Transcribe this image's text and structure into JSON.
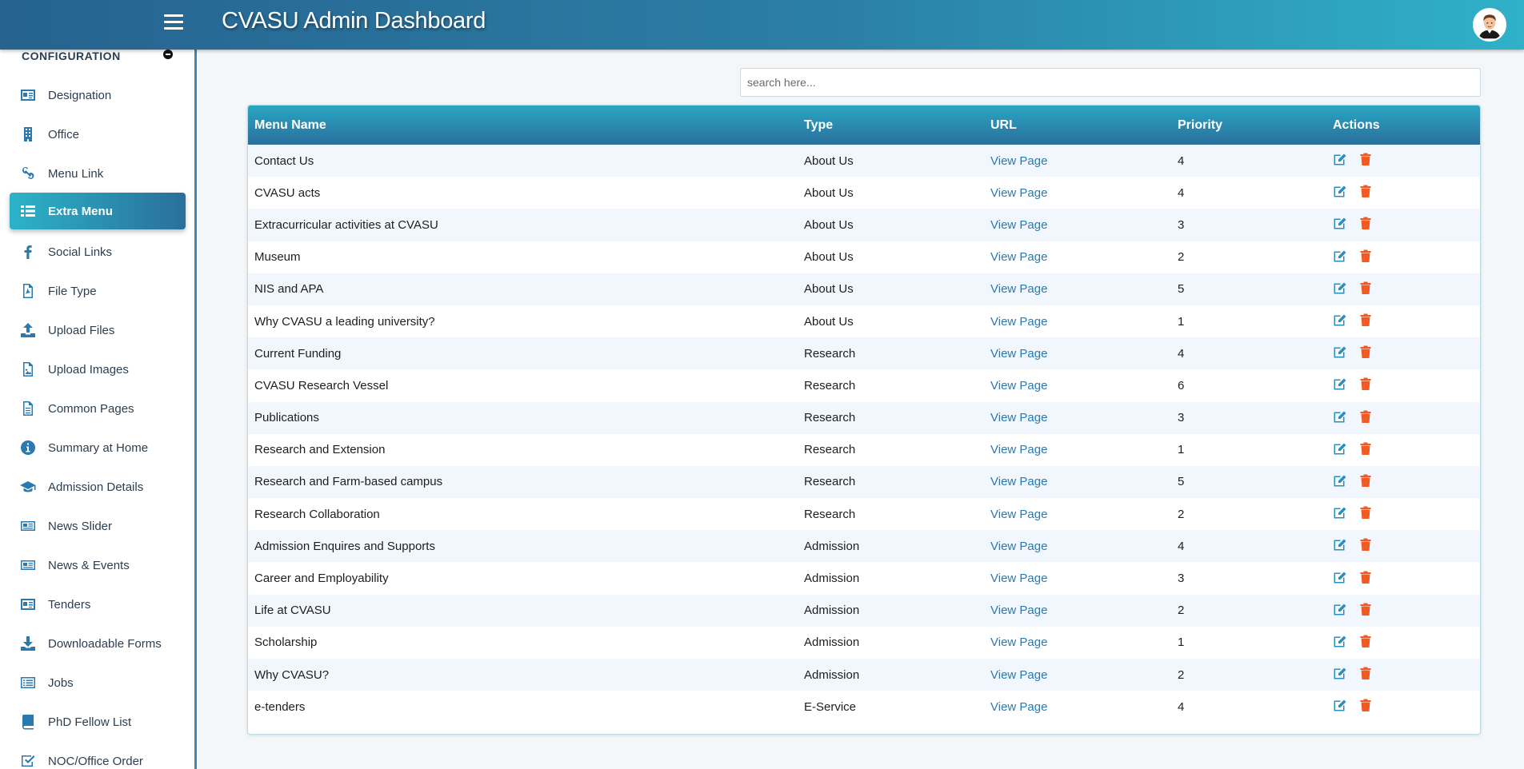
{
  "header": {
    "title": "CVASU Admin Dashboard",
    "menu_icon": "hamburger-menu-icon",
    "avatar_icon": "user-avatar-icon"
  },
  "sidebar": {
    "section_title": "CONFIGURATION",
    "collapse_icon": "minus-circle-icon",
    "active_item": "Extra Menu",
    "items": [
      {
        "label": "Designation",
        "icon": "id-card-icon"
      },
      {
        "label": "Office",
        "icon": "building-icon"
      },
      {
        "label": "Menu Link",
        "icon": "link-icon"
      },
      {
        "label": "Extra Menu",
        "icon": "list-icon"
      },
      {
        "label": "Social Links",
        "icon": "facebook-icon"
      },
      {
        "label": "File Type",
        "icon": "file-pdf-icon"
      },
      {
        "label": "Upload Files",
        "icon": "upload-icon"
      },
      {
        "label": "Upload Images",
        "icon": "image-file-icon"
      },
      {
        "label": "Common Pages",
        "icon": "document-icon"
      },
      {
        "label": "Summary at Home",
        "icon": "info-icon"
      },
      {
        "label": "Admission Details",
        "icon": "graduation-cap-icon"
      },
      {
        "label": "News Slider",
        "icon": "newspaper-icon"
      },
      {
        "label": "News & Events",
        "icon": "newspaper-icon"
      },
      {
        "label": "Tenders",
        "icon": "id-card-icon"
      },
      {
        "label": "Downloadable Forms",
        "icon": "download-icon"
      },
      {
        "label": "Jobs",
        "icon": "list-alt-icon"
      },
      {
        "label": "PhD Fellow List",
        "icon": "book-icon"
      },
      {
        "label": "NOC/Office Order",
        "icon": "check-square-icon"
      }
    ]
  },
  "search": {
    "placeholder": "search here...",
    "value": ""
  },
  "table": {
    "columns": [
      "Menu Name",
      "Type",
      "URL",
      "Priority",
      "Actions"
    ],
    "action_icons": [
      "edit-icon",
      "trash-icon"
    ],
    "colors": {
      "edit": "#2a8fc0",
      "delete": "#f05a24",
      "link": "#2a7ab0"
    },
    "rows": [
      {
        "name": "Contact Us",
        "type": "About Us",
        "url": "View Page",
        "priority": "4"
      },
      {
        "name": "CVASU acts",
        "type": "About Us",
        "url": "View Page",
        "priority": "4"
      },
      {
        "name": "Extracurricular activities at CVASU",
        "type": "About Us",
        "url": "View Page",
        "priority": "3"
      },
      {
        "name": "Museum",
        "type": "About Us",
        "url": "View Page",
        "priority": "2"
      },
      {
        "name": "NIS and APA",
        "type": "About Us",
        "url": "View Page",
        "priority": "5"
      },
      {
        "name": "Why CVASU a leading university?",
        "type": "About Us",
        "url": "View Page",
        "priority": "1"
      },
      {
        "name": "Current Funding",
        "type": "Research",
        "url": "View Page",
        "priority": "4"
      },
      {
        "name": "CVASU Research Vessel",
        "type": "Research",
        "url": "View Page",
        "priority": "6"
      },
      {
        "name": "Publications",
        "type": "Research",
        "url": "View Page",
        "priority": "3"
      },
      {
        "name": "Research and Extension",
        "type": "Research",
        "url": "View Page",
        "priority": "1"
      },
      {
        "name": "Research and Farm-based campus",
        "type": "Research",
        "url": "View Page",
        "priority": "5"
      },
      {
        "name": "Research Collaboration",
        "type": "Research",
        "url": "View Page",
        "priority": "2"
      },
      {
        "name": "Admission Enquires and Supports",
        "type": "Admission",
        "url": "View Page",
        "priority": "4"
      },
      {
        "name": "Career and Employability",
        "type": "Admission",
        "url": "View Page",
        "priority": "3"
      },
      {
        "name": "Life at CVASU",
        "type": "Admission",
        "url": "View Page",
        "priority": "2"
      },
      {
        "name": "Scholarship",
        "type": "Admission",
        "url": "View Page",
        "priority": "1"
      },
      {
        "name": "Why CVASU?",
        "type": "Admission",
        "url": "View Page",
        "priority": "2"
      },
      {
        "name": "e-tenders",
        "type": "E-Service",
        "url": "View Page",
        "priority": "4"
      }
    ]
  }
}
